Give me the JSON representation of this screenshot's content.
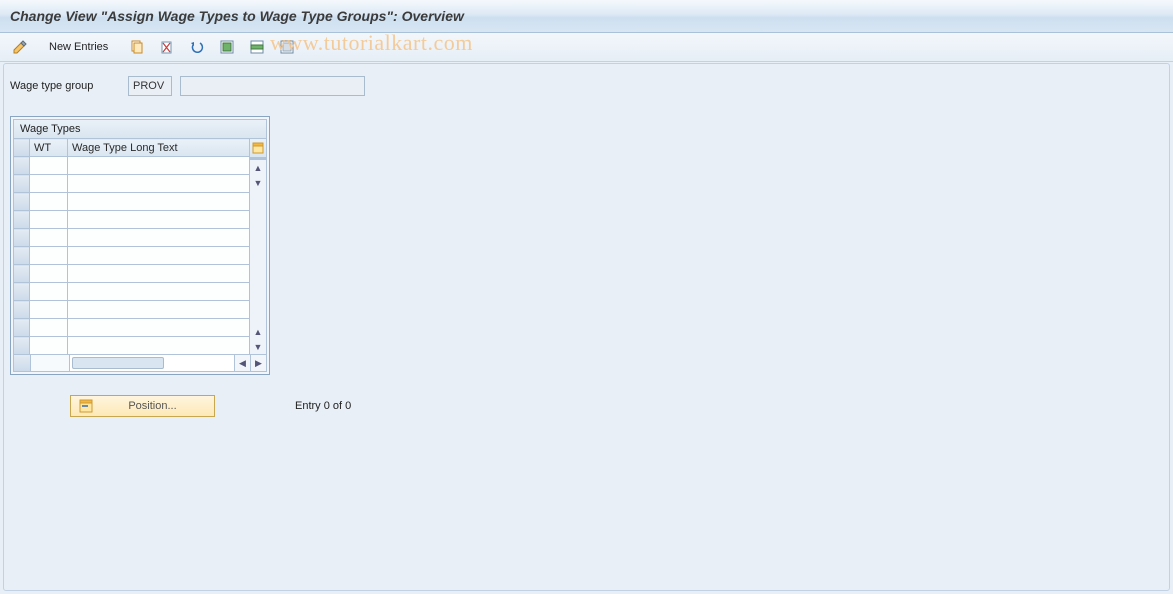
{
  "title": "Change View \"Assign Wage Types to Wage Type Groups\": Overview",
  "toolbar": {
    "new_entries_label": "New Entries"
  },
  "watermark": "www.tutorialkart.com",
  "form": {
    "wage_type_group_label": "Wage type group",
    "wage_type_group_code": "PROV",
    "wage_type_group_desc": ""
  },
  "table": {
    "title": "Wage Types",
    "columns": {
      "wt": "WT",
      "long": "Wage Type Long Text"
    },
    "rows": [
      "",
      "",
      "",
      "",
      "",
      "",
      "",
      "",
      "",
      "",
      ""
    ]
  },
  "footer": {
    "position_label": "Position...",
    "entry_text": "Entry 0 of 0"
  }
}
